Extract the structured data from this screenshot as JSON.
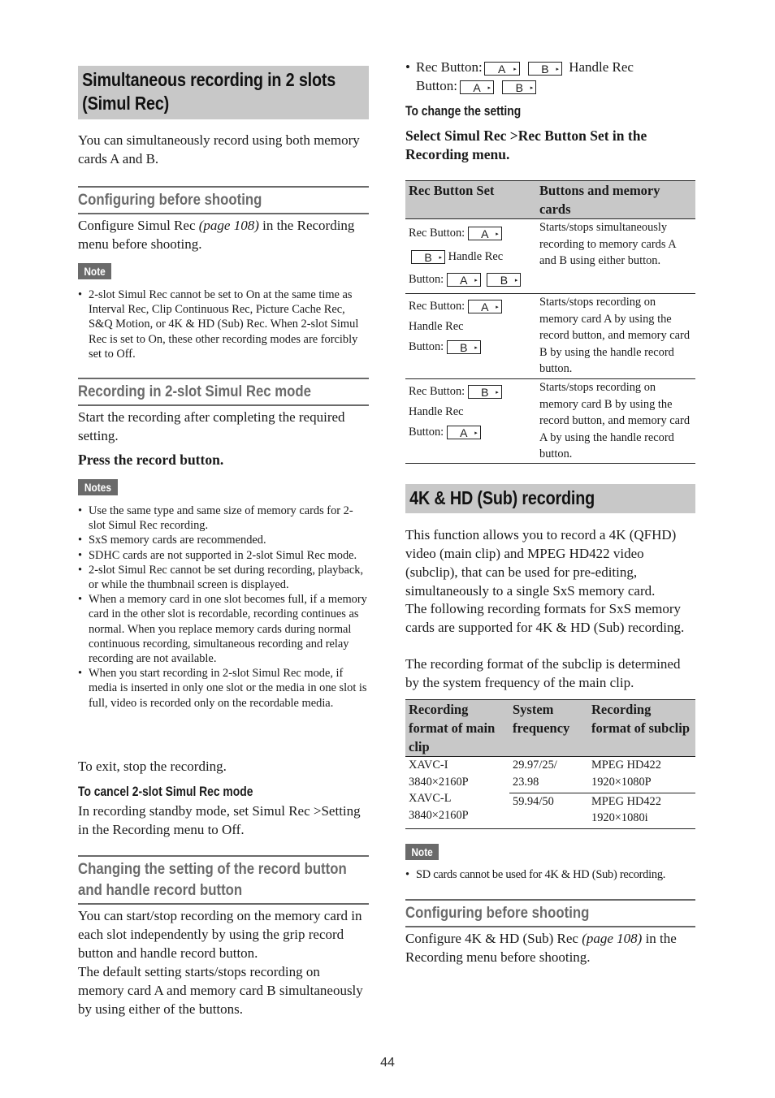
{
  "left": {
    "section1": {
      "title_line1": "Simultaneous recording in 2 slots",
      "title_line2": "(Simul Rec)",
      "intro": "You can simultaneously record using both memory cards A and B."
    },
    "config": {
      "heading": "Configuring before shooting",
      "text_before": "Configure Simul Rec ",
      "link": "(page 108)",
      "text_after": " in the Recording menu before shooting.",
      "note_label": "Note",
      "note_items": [
        "2-slot Simul Rec cannot be set to On at the same time as Interval Rec, Clip Continuous Rec, Picture Cache Rec, S&Q Motion, or 4K & HD (Sub) Rec. When 2-slot Simul Rec is set to On, these other recording modes are forcibly set to Off."
      ]
    },
    "recording_mode": {
      "heading": "Recording in 2-slot Simul Rec mode",
      "intro": "Start the recording after completing the required setting.",
      "step": "Press the record button.",
      "notes_label": "Notes",
      "notes_items": [
        "Use the same type and same size of memory cards for 2-slot Simul Rec recording.",
        "SxS memory cards are recommended.",
        "SDHC cards are not supported in 2-slot Simul Rec mode.",
        "2-slot Simul Rec cannot be set during recording, playback, or while the thumbnail screen is displayed.",
        "When a memory card in one slot becomes full, if a memory card in the other slot is recordable, recording continues as normal. When you replace memory cards during normal continuous recording, simultaneous recording and relay recording are not available.",
        "When you start recording in 2-slot Simul Rec mode, if media is inserted in only one slot or the media in one slot is full, video is recorded only on the recordable media."
      ],
      "exit_text": "To exit, stop the recording.",
      "cancel_heading": "To cancel 2-slot Simul Rec mode",
      "cancel_text": "In recording standby mode, set Simul Rec >Setting in the Recording menu to Off."
    },
    "changing": {
      "heading_line1": "Changing the setting of the record button",
      "heading_line2": "and handle record button",
      "para1": "You can start/stop recording on the memory card in each slot independently by using the grip record button and handle record button.",
      "para2": "The default setting starts/stops recording on memory card A and memory card B simultaneously by using either of the buttons."
    }
  },
  "right": {
    "default_bullet": {
      "rec_button_label": "Rec Button:",
      "handle_label_1": "Handle Rec",
      "handle_label_2": "Button:",
      "rec_buttons": [
        "A",
        "B"
      ],
      "handle_buttons": [
        "A",
        "B"
      ]
    },
    "change_setting": {
      "heading": "To change the setting",
      "step": "Select Simul Rec >Rec Button Set in the Recording menu."
    },
    "rec_button_table": {
      "headers": [
        "Rec Button Set",
        "Buttons and memory cards"
      ],
      "rows": [
        {
          "rec_label": "Rec Button:",
          "rec_buttons": [
            "A",
            "B"
          ],
          "handle_label": "Handle Rec",
          "button_label": "Button:",
          "handle_buttons": [
            "A",
            "B"
          ],
          "description": "Starts/stops simultaneously recording to memory cards A and B using either button."
        },
        {
          "rec_label": "Rec Button:",
          "rec_buttons": [
            "A"
          ],
          "handle_label": "Handle Rec",
          "button_label": "Button:",
          "handle_buttons": [
            "B"
          ],
          "description": "Starts/stops recording on memory card A by using the record button, and memory card B by using the handle record button."
        },
        {
          "rec_label": "Rec Button:",
          "rec_buttons": [
            "B"
          ],
          "handle_label": "Handle Rec",
          "button_label": "Button:",
          "handle_buttons": [
            "A"
          ],
          "description": "Starts/stops recording on memory card B by using the record button, and memory card A by using the handle record button."
        }
      ]
    },
    "section4k": {
      "title": "4K & HD (Sub) recording",
      "para1": "This function allows you to record a 4K (QFHD) video (main clip) and MPEG HD422 video (subclip), that can be used for pre-editing, simultaneously to a single SxS memory card.",
      "para2": "The following recording formats for SxS memory cards are supported for 4K & HD (Sub) recording.",
      "para3": "The recording format of the subclip is determined by the system frequency of the main clip."
    },
    "format_table": {
      "headers": [
        "Recording format of main clip",
        "System frequency",
        "Recording format of subclip"
      ],
      "main_formats": [
        "XAVC-I 3840×2160P",
        "XAVC-L 3840×2160P"
      ],
      "rows": [
        {
          "frequency": "29.97/25/ 23.98",
          "subclip": "MPEG HD422 1920×1080P"
        },
        {
          "frequency": "59.94/50",
          "subclip": "MPEG HD422 1920×1080i"
        }
      ]
    },
    "note": {
      "label": "Note",
      "items": [
        "SD cards cannot be used for 4K & HD (Sub) recording."
      ]
    },
    "config": {
      "heading": "Configuring before shooting",
      "text_before": "Configure 4K & HD (Sub) Rec ",
      "link": "(page 108)",
      "text_after": " in the Recording menu before shooting."
    }
  },
  "footer": {
    "page_number": "44"
  }
}
